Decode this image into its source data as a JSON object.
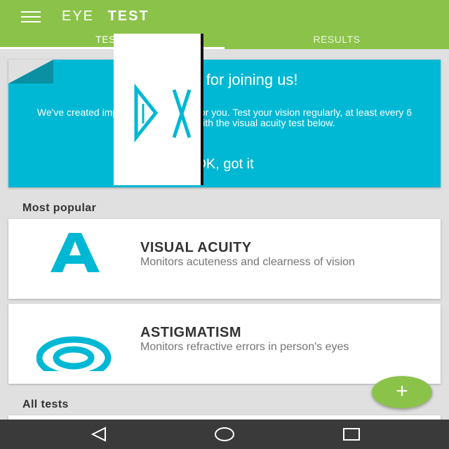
{
  "appbar": {
    "title_part1": "EYE",
    "title_part2": "TEST",
    "menu_icon": "hamburger-menu-icon",
    "color": "#8bc34a"
  },
  "tabs": [
    {
      "label": "TESTS",
      "active": true
    },
    {
      "label": "RESULTS",
      "active": false
    }
  ],
  "welcome": {
    "title": "Thanks for joining us!",
    "body": "We've created important vision tests for you. Test your vision regularly, at least every 6 months. Start now with the visual acuity test below.",
    "action": "OK, got it",
    "color": "#00b8d4"
  },
  "sections": {
    "popular_label": "Most popular",
    "all_label": "All tests"
  },
  "tests": [
    {
      "title": "VISUAL ACUITY",
      "description": "Monitors acuteness and clearness of vision",
      "icon": "letter-a-icon"
    },
    {
      "title": "ASTIGMATISM",
      "description": "Monitors refractive errors in person's eyes",
      "icon": "target-rings-icon"
    }
  ],
  "fab": {
    "label": "+",
    "icon": "plus-icon"
  },
  "navbar": {
    "buttons": [
      "back-icon",
      "home-icon",
      "recents-icon"
    ]
  }
}
